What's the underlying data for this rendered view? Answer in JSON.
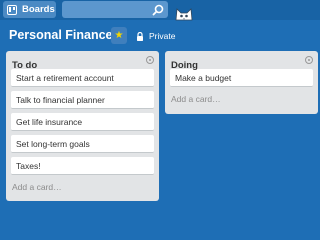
{
  "header": {
    "boards_label": "Boards",
    "search_placeholder": ""
  },
  "board": {
    "title": "Personal Finances",
    "star_symbol": "★",
    "privacy_label": "Private"
  },
  "lists": [
    {
      "title": "To do",
      "cards": [
        "Start a retirement account",
        "Talk to financial planner",
        "Get life insurance",
        "Set long-term goals",
        "Taxes!"
      ],
      "add_card_label": "Add a card…"
    },
    {
      "title": "Doing",
      "cards": [
        "Make a budget"
      ],
      "add_card_label": "Add a card…"
    }
  ],
  "colors": {
    "background": "#1e6eb5",
    "header": "#1863a5",
    "list_bg": "#e2e4e6",
    "star": "#f2d600"
  }
}
